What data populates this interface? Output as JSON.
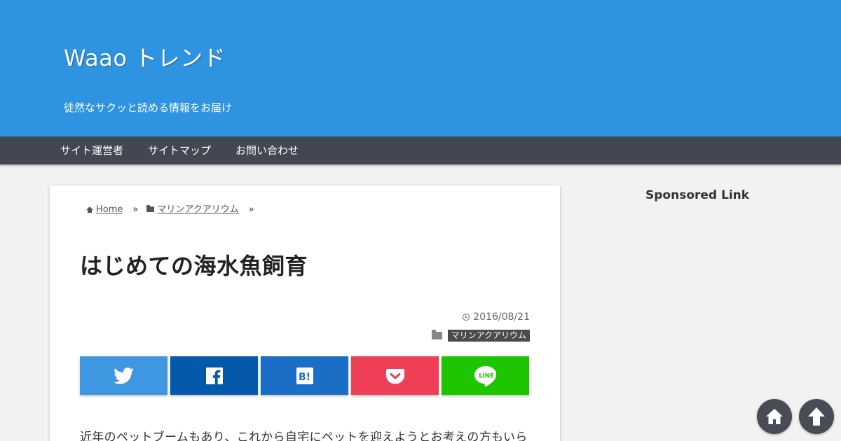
{
  "header": {
    "site_title": "Waao トレンド",
    "tagline": "徒然なサクッと読める情報をお届け"
  },
  "nav": {
    "items": [
      {
        "label": "サイト運営者"
      },
      {
        "label": "サイトマップ"
      },
      {
        "label": "お問い合わせ"
      }
    ]
  },
  "breadcrumb": {
    "home": "Home",
    "category": "マリンアクアリウム",
    "separator": "»"
  },
  "post": {
    "title": "はじめての海水魚飼育",
    "date": "2016/08/21",
    "category": "マリンアクアリウム",
    "body_first_line": "近年のペットブームもあり、これから自宅にペットを迎えようとお考えの方もいら"
  },
  "share": {
    "buttons": [
      {
        "service": "twitter",
        "icon": "twitter-icon",
        "color": "#3e97e0"
      },
      {
        "service": "facebook",
        "icon": "facebook-icon",
        "color": "#0559aa"
      },
      {
        "service": "hatena",
        "icon": "hatena-bookmark-icon",
        "color": "#1a6ec6"
      },
      {
        "service": "pocket",
        "icon": "pocket-icon",
        "color": "#ef3f56"
      },
      {
        "service": "line",
        "icon": "line-icon",
        "color": "#1dc600"
      }
    ]
  },
  "sidebar": {
    "title": "Sponsored Link"
  },
  "floating": {
    "home_icon": "home-icon",
    "top_icon": "arrow-up-icon"
  },
  "colors": {
    "header_bg": "#2e93e0",
    "nav_bg": "#434751",
    "page_bg": "#f2f2f2",
    "float_btn_bg": "#4a4c55"
  }
}
